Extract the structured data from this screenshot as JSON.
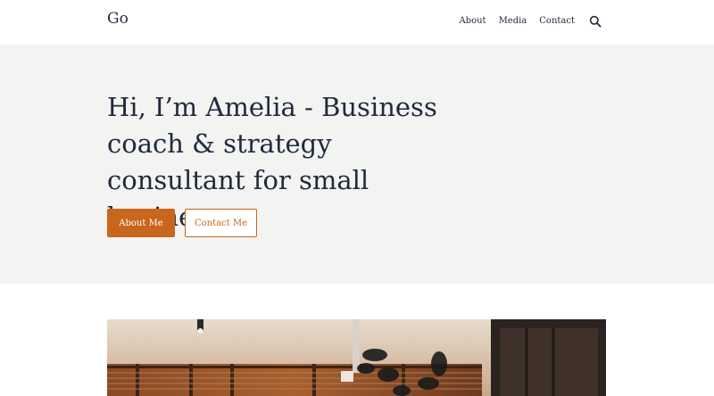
{
  "header": {
    "logo": "Go",
    "nav": [
      "About",
      "Media",
      "Contact"
    ],
    "search_icon": "search-icon"
  },
  "hero": {
    "headline": "Hi, I’m Amelia - Business coach & strategy consultant for small businesses.",
    "primary_button": "About Me",
    "secondary_button": "Contact Me"
  },
  "colors": {
    "accent": "#c8661b",
    "text": "#1f2a3c",
    "hero_bg": "#f3f3f2"
  }
}
